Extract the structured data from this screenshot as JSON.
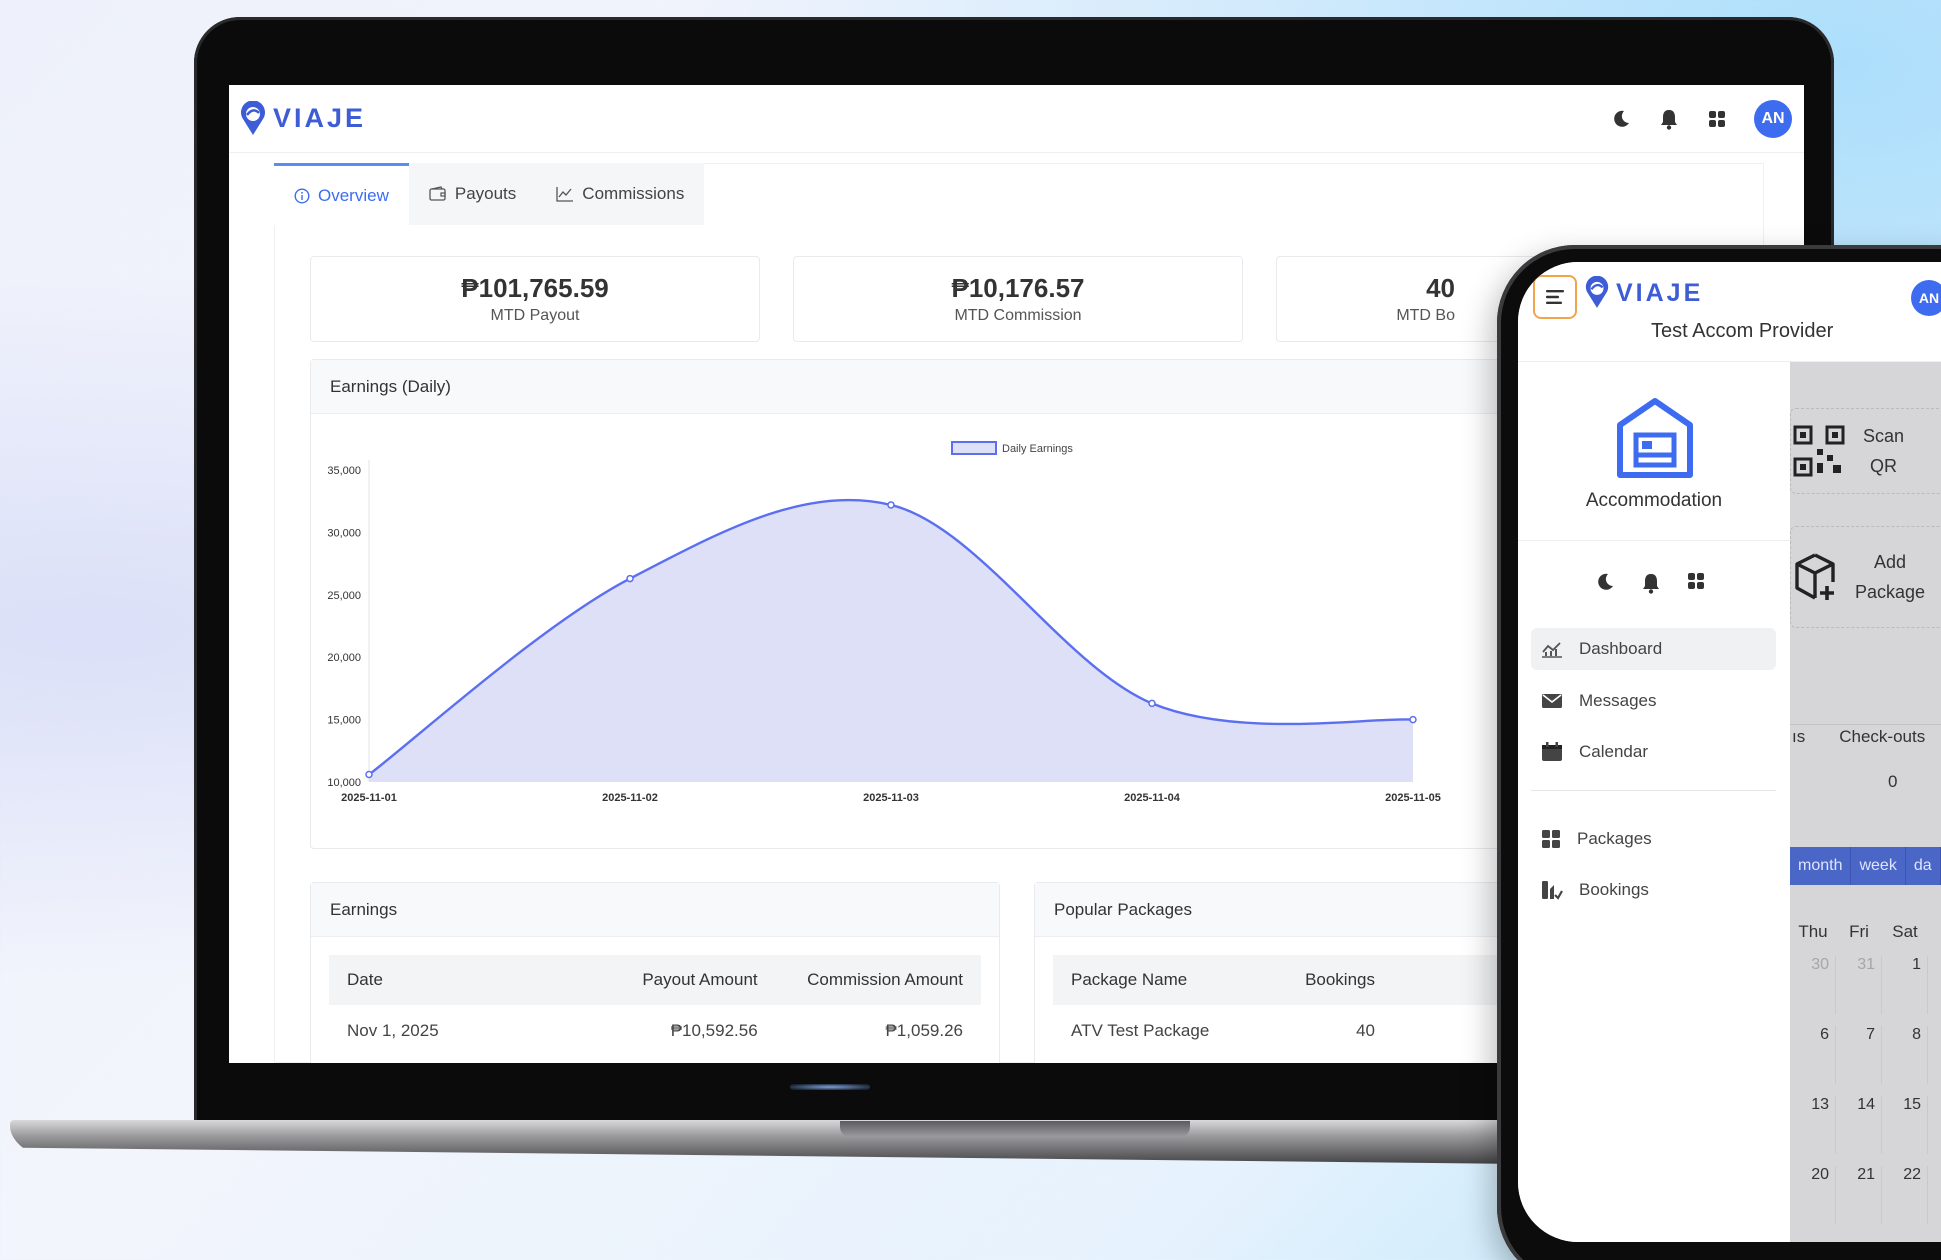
{
  "brand": {
    "name": "VIAJE",
    "color": "#3d5cd6"
  },
  "desktop": {
    "avatar_initials": "AN",
    "top_icons": [
      "moon-icon",
      "bell-icon",
      "apps-grid-icon"
    ],
    "tabs": [
      {
        "label": "Overview",
        "icon": "info-icon"
      },
      {
        "label": "Payouts",
        "icon": "wallet-icon"
      },
      {
        "label": "Commissions",
        "icon": "line-chart-icon"
      }
    ],
    "kpis": [
      {
        "value": "₱101,765.59",
        "label": "MTD Payout"
      },
      {
        "value": "₱10,176.57",
        "label": "MTD Commission"
      },
      {
        "value": "40",
        "label": "MTD Bo"
      }
    ],
    "earnings_chart_title": "Earnings (Daily)",
    "earnings_table": {
      "title": "Earnings",
      "columns": [
        "Date",
        "Payout Amount",
        "Commission Amount"
      ],
      "rows": [
        [
          "Nov 1, 2025",
          "₱10,592.56",
          "₱1,059.26"
        ]
      ]
    },
    "popular_packages": {
      "title": "Popular Packages",
      "columns": [
        "Package Name",
        "Bookings"
      ],
      "rows": [
        [
          "ATV Test Package",
          "40"
        ]
      ]
    }
  },
  "chart_data": {
    "type": "area",
    "title": "Earnings (Daily)",
    "x": [
      "2025-11-01",
      "2025-11-02",
      "2025-11-03",
      "2025-11-04",
      "2025-11-05"
    ],
    "series": [
      {
        "name": "Daily Earnings",
        "values": [
          10600,
          26300,
          32200,
          16300,
          15000
        ]
      }
    ],
    "ylim": [
      10000,
      35000
    ],
    "yticks": [
      "35,000",
      "30,000",
      "25,000",
      "20,000",
      "15,000",
      "10,000"
    ],
    "legend": "top",
    "color": "#5b6ff0",
    "fill": "#dde0f7"
  },
  "mobile": {
    "provider_title": "Test Accom Provider",
    "avatar_initials": "AN",
    "category_label": "Accommodation",
    "nav_primary": [
      {
        "label": "Dashboard",
        "icon": "chart-icon"
      },
      {
        "label": "Messages",
        "icon": "mail-icon"
      },
      {
        "label": "Calendar",
        "icon": "calendar-icon"
      }
    ],
    "nav_secondary": [
      {
        "label": "Packages",
        "icon": "grid-icon"
      },
      {
        "label": "Bookings",
        "icon": "bookings-icon"
      }
    ],
    "overlay": {
      "scan_qr": [
        "Scan",
        "QR"
      ],
      "add_package": [
        "Add",
        "Package"
      ],
      "stats_headers": [
        "ıs",
        "Check-outs"
      ],
      "stats_value": "0",
      "view_tabs": [
        "month",
        "week",
        "da"
      ],
      "weekdays": [
        "Thu",
        "Fri",
        "Sat"
      ],
      "weeks": [
        [
          "30",
          "31",
          "1"
        ],
        [
          "6",
          "7",
          "8"
        ],
        [
          "13",
          "14",
          "15"
        ],
        [
          "20",
          "21",
          "22"
        ]
      ]
    }
  }
}
